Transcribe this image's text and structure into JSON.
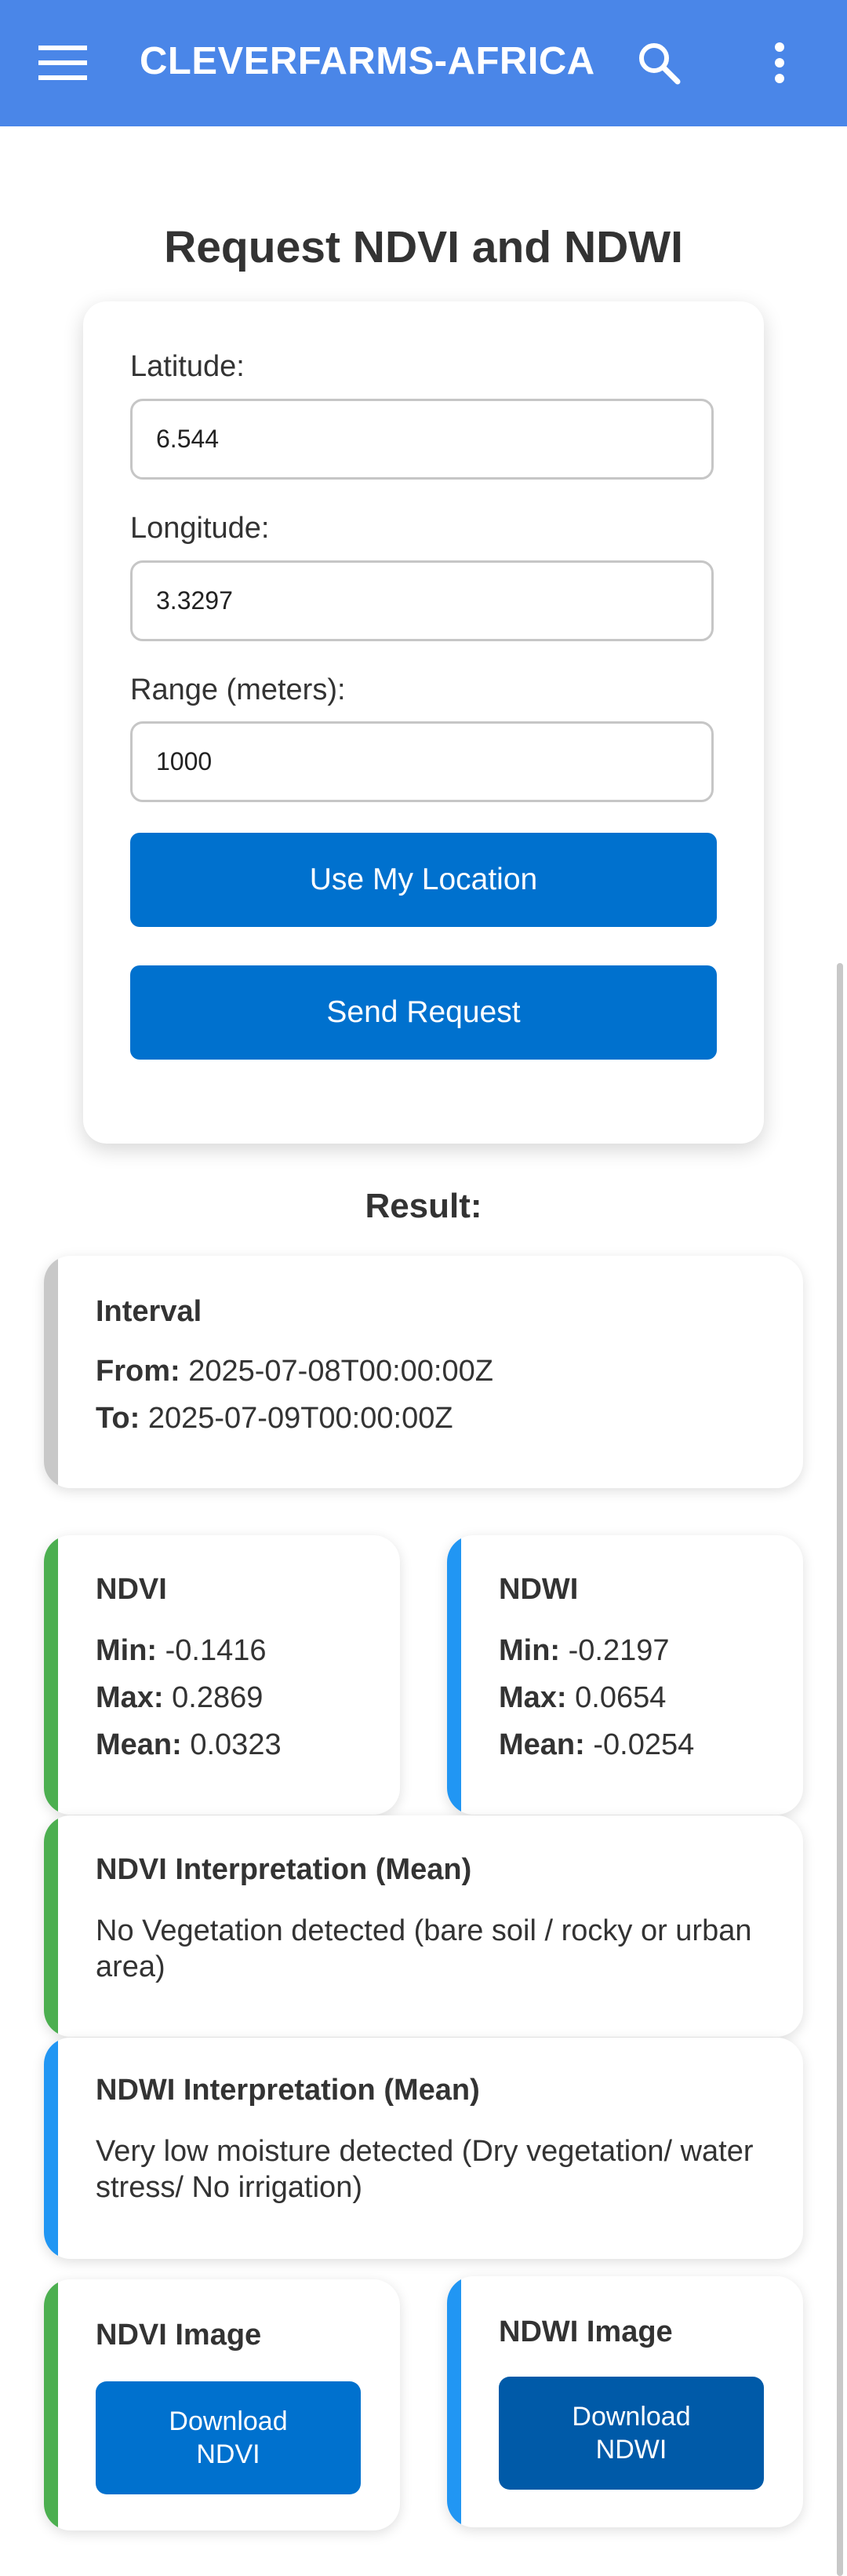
{
  "appbar": {
    "title": "CLEVERFARMS-AFRICA",
    "menu_icon": "hamburger-menu-icon",
    "search_icon": "search-icon",
    "more_icon": "more-vertical-icon",
    "color": "#4a86e8"
  },
  "form": {
    "title": "Request NDVI and NDWI",
    "latitude_label": "Latitude:",
    "latitude_value": "6.544",
    "longitude_label": "Longitude:",
    "longitude_value": "3.3297",
    "range_label": "Range (meters):",
    "range_value": "1000",
    "use_location_label": "Use My Location",
    "send_request_label": "Send Request"
  },
  "result": {
    "title": "Result:",
    "interval": {
      "heading": "Interval",
      "from_label": "From:",
      "from_value": "2025-07-08T00:00:00Z",
      "to_label": "To:",
      "to_value": "2025-07-09T00:00:00Z"
    },
    "ndvi": {
      "heading": "NDVI",
      "min_label": "Min:",
      "min_value": "-0.1416",
      "max_label": "Max:",
      "max_value": "0.2869",
      "mean_label": "Mean:",
      "mean_value": "0.0323"
    },
    "ndwi": {
      "heading": "NDWI",
      "min_label": "Min:",
      "min_value": "-0.2197",
      "max_label": "Max:",
      "max_value": "0.0654",
      "mean_label": "Mean:",
      "mean_value": "-0.0254"
    },
    "ndvi_interpretation": {
      "heading": "NDVI Interpretation (Mean)",
      "text": "No Vegetation detected (bare soil / rocky or urban area)"
    },
    "ndwi_interpretation": {
      "heading": "NDWI Interpretation (Mean)",
      "text": "Very low moisture detected (Dry vegetation/ water stress/ No irrigation)"
    },
    "ndvi_image": {
      "heading": "NDVI Image",
      "button_line1": "Download",
      "button_line2": "NDVI"
    },
    "ndwi_image": {
      "heading": "NDWI Image",
      "button_line1": "Download",
      "button_line2": "NDWI"
    }
  },
  "colors": {
    "primary_button": "#0071ce",
    "secondary_button": "#005aa8",
    "ndvi_accent": "#4caf50",
    "ndwi_accent": "#2196f3",
    "interval_accent": "#c8c8c8"
  }
}
